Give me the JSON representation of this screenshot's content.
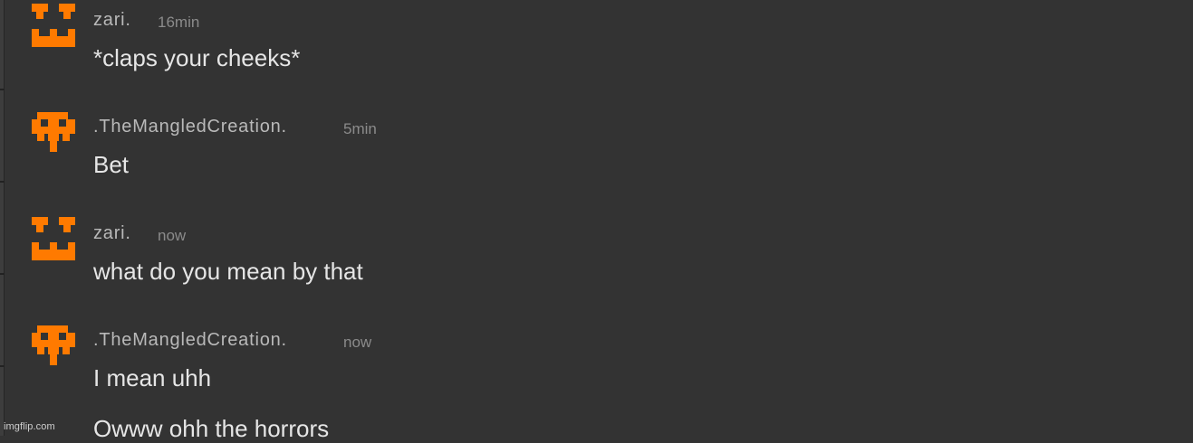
{
  "colors": {
    "background": "#333333",
    "avatar_orange": "#ff7a00",
    "username": "#b9b9b9",
    "timestamp": "#8b8b8b",
    "message_text": "#e6e6e6"
  },
  "messages": [
    {
      "username": "zari.",
      "time": "16min",
      "avatar_icon": "orange-pixel-face-icon",
      "lines": [
        "*claps your cheeks*"
      ]
    },
    {
      "username": ".TheMangledCreation.",
      "time": "5min",
      "avatar_icon": "orange-pixel-skull-icon",
      "lines": [
        "Bet"
      ]
    },
    {
      "username": "zari.",
      "time": "now",
      "avatar_icon": "orange-pixel-face-icon",
      "lines": [
        "what do you mean by that"
      ]
    },
    {
      "username": ".TheMangledCreation.",
      "time": "now",
      "avatar_icon": "orange-pixel-skull-icon",
      "lines": [
        "I mean uhh",
        "Owww ohh the horrors"
      ]
    }
  ],
  "watermark": "imgflip.com"
}
